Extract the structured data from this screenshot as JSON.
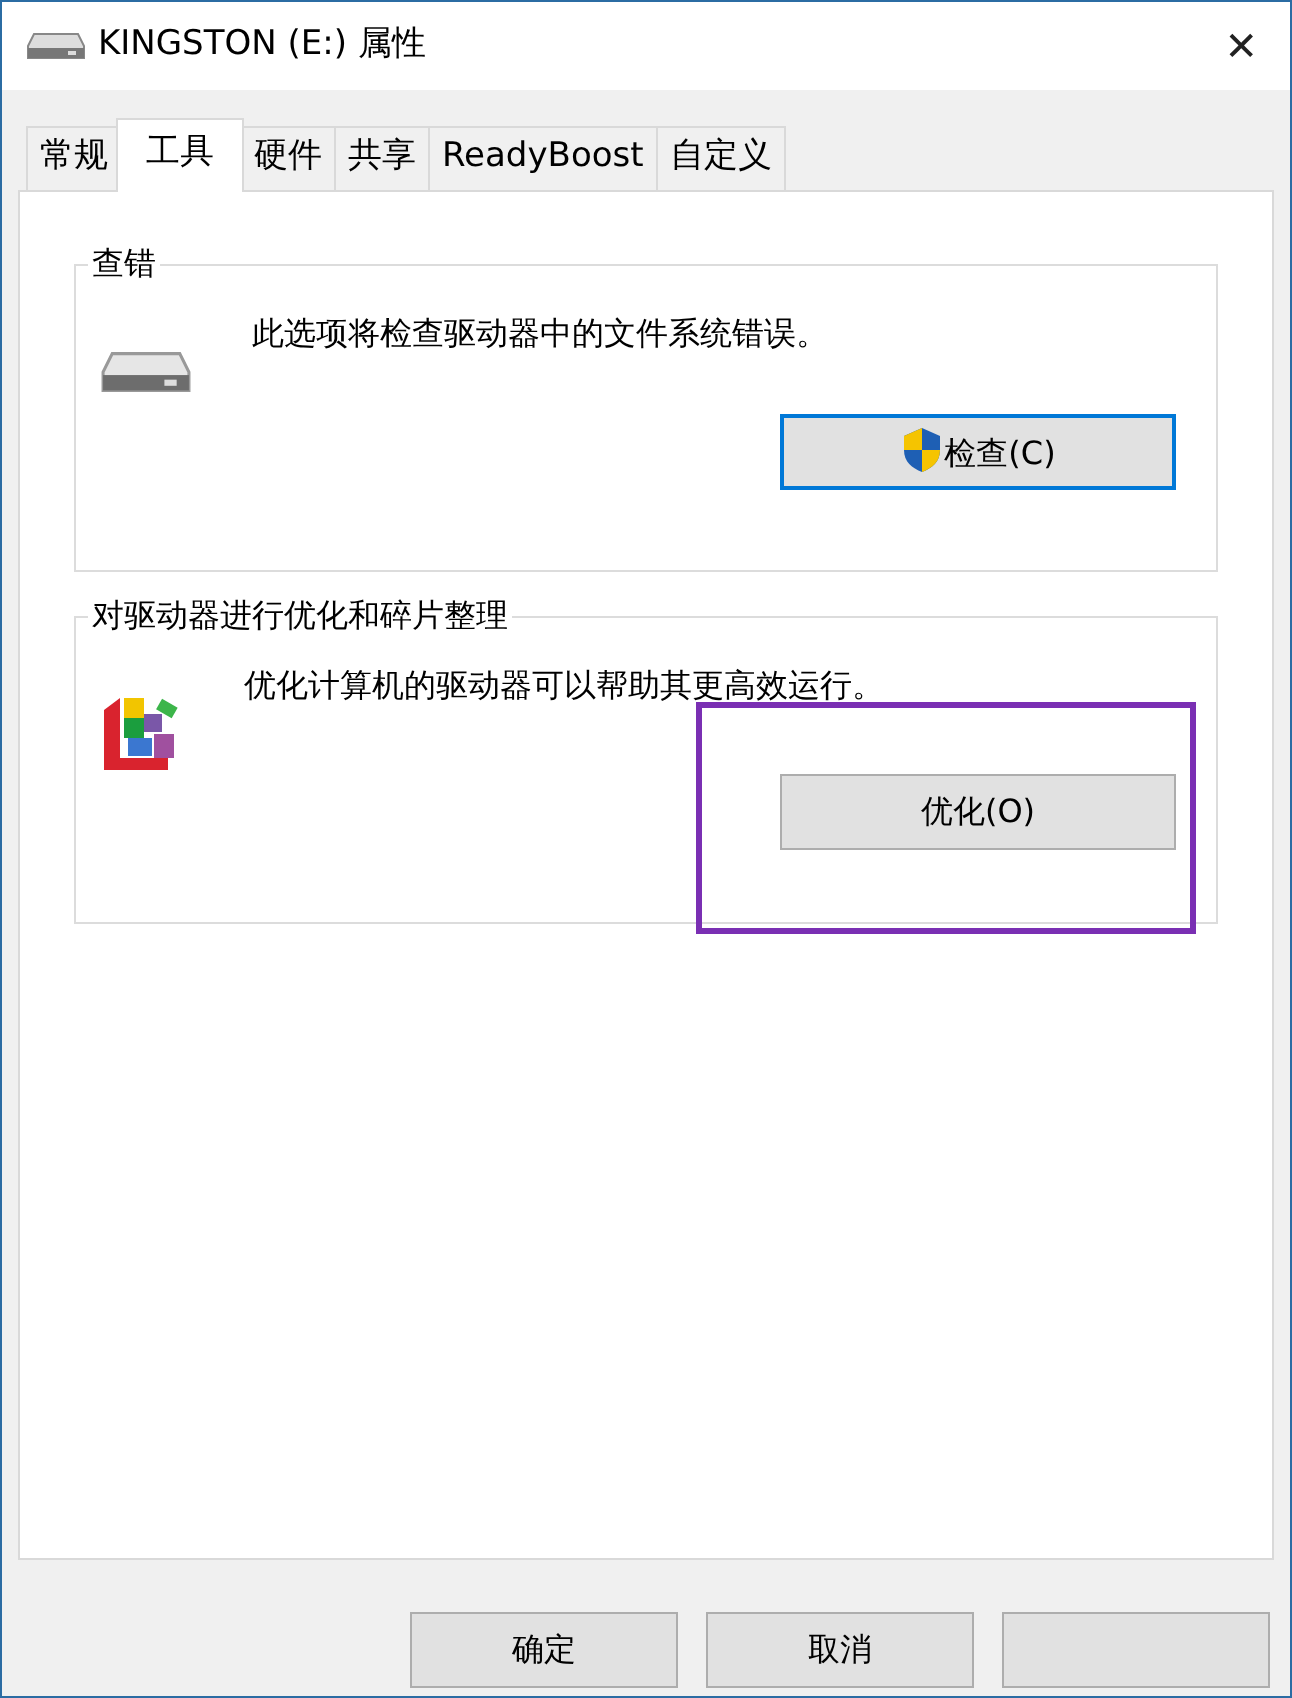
{
  "window": {
    "title": "KINGSTON (E:) 属性",
    "close": "✕"
  },
  "tabs": [
    {
      "label": "常规",
      "selected": false
    },
    {
      "label": "工具",
      "selected": true
    },
    {
      "label": "硬件",
      "selected": false
    },
    {
      "label": "共享",
      "selected": false
    },
    {
      "label": "ReadyBoost",
      "selected": false
    },
    {
      "label": "自定义",
      "selected": false
    }
  ],
  "groups": [
    {
      "kind": "check",
      "title": "查错",
      "description": "此选项将检查驱动器中的文件系统错误。",
      "button": {
        "label": "检查(C)",
        "shield": true,
        "focused": true
      },
      "highlighted": false
    },
    {
      "kind": "optimize",
      "title": "对驱动器进行优化和碎片整理",
      "description": "优化计算机的驱动器可以帮助其更高效运行。",
      "button": {
        "label": "优化(O)",
        "shield": false,
        "focused": false
      },
      "highlighted": true
    }
  ],
  "footer_buttons": [
    {
      "kind": "labeled",
      "label": "确定"
    },
    {
      "kind": "labeled",
      "label": "取消"
    },
    {
      "kind": "covered"
    }
  ]
}
